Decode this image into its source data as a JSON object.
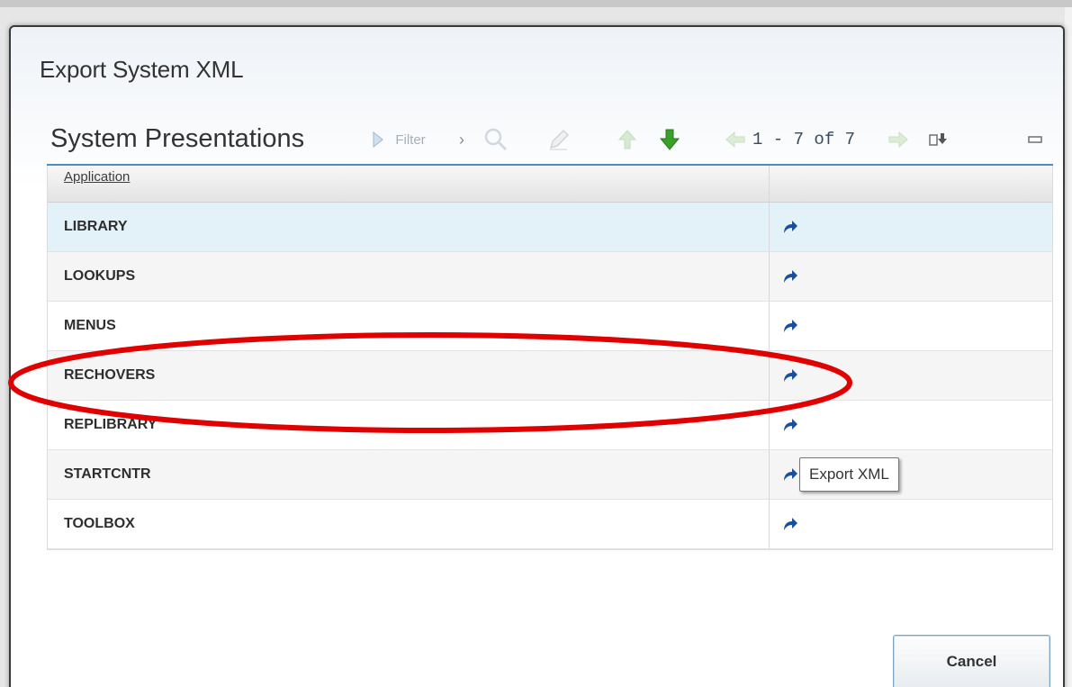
{
  "dialog": {
    "title": "Export System XML"
  },
  "panel": {
    "title": "System Presentations",
    "filter_label": "Filter",
    "range_text": "1 - 7 of 7"
  },
  "grid": {
    "columns": [
      "Application",
      ""
    ],
    "rows": [
      {
        "name": "LIBRARY",
        "state": "selected"
      },
      {
        "name": "LOOKUPS",
        "state": "alt"
      },
      {
        "name": "MENUS",
        "state": "normal"
      },
      {
        "name": "RECHOVERS",
        "state": "alt"
      },
      {
        "name": "REPLIBRARY",
        "state": "normal"
      },
      {
        "name": "STARTCNTR",
        "state": "alt"
      },
      {
        "name": "TOOLBOX",
        "state": "normal"
      }
    ]
  },
  "tooltip": {
    "text": "Export XML"
  },
  "footer": {
    "cancel_label": "Cancel"
  },
  "icons": {
    "filter": "play-triangle-icon",
    "search": "magnifier-icon",
    "edit": "pencil-icon",
    "up": "arrow-up-icon",
    "down": "arrow-down-icon",
    "prev": "arrow-left-icon",
    "next": "arrow-right-icon",
    "download": "download-icon",
    "collapse": "minimize-icon",
    "export": "curved-arrow-icon"
  },
  "colors": {
    "accent": "#4a8fc0",
    "selected_row": "#e3f1f8",
    "highlight": "#e00000",
    "export_icon": "#1a4f9c",
    "down_arrow": "#3aa02a"
  }
}
